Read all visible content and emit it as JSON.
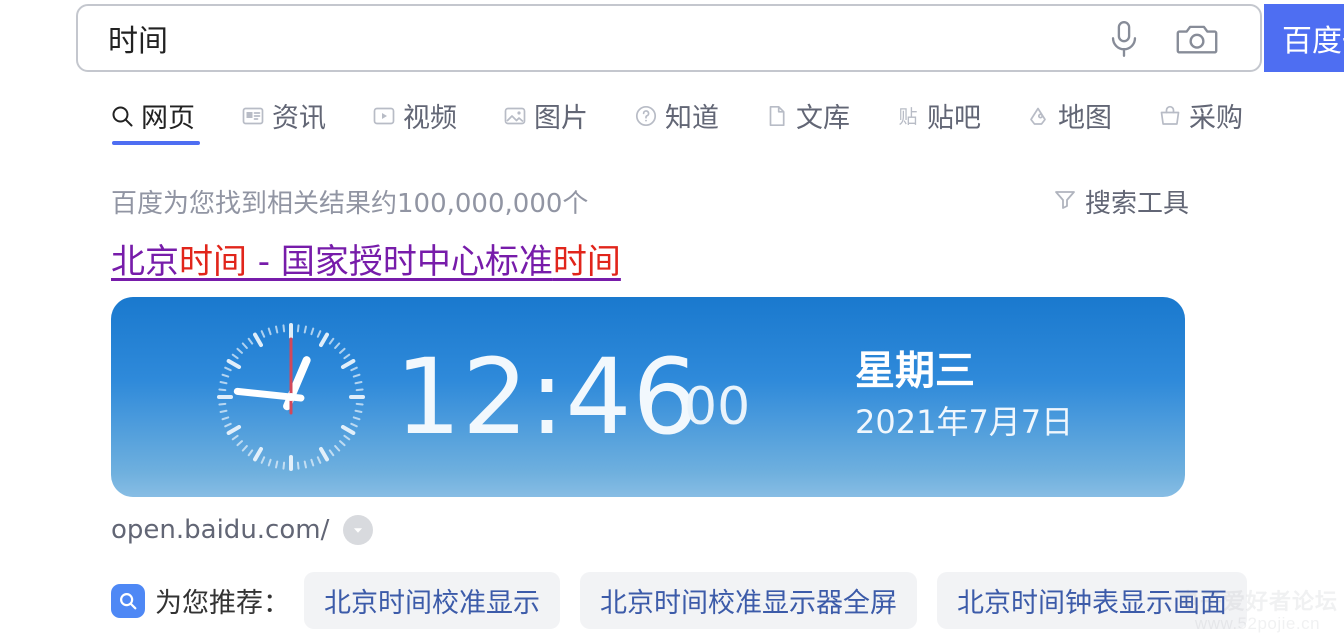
{
  "header": {
    "logo_text": "度",
    "search_value": "时间",
    "search_placeholder": "",
    "mic_icon": "microphone-icon",
    "camera_icon": "camera-icon",
    "search_button_label": "百度一下"
  },
  "tabs": [
    {
      "label": "网页",
      "icon": "search-icon",
      "active": true
    },
    {
      "label": "资讯",
      "icon": "news-icon",
      "active": false
    },
    {
      "label": "视频",
      "icon": "video-icon",
      "active": false
    },
    {
      "label": "图片",
      "icon": "image-icon",
      "active": false
    },
    {
      "label": "知道",
      "icon": "question-icon",
      "active": false
    },
    {
      "label": "文库",
      "icon": "document-icon",
      "active": false
    },
    {
      "label": "贴吧",
      "icon": "tieba-icon",
      "active": false
    },
    {
      "label": "地图",
      "icon": "map-pin-icon",
      "active": false
    },
    {
      "label": "采购",
      "icon": "basket-icon",
      "active": false
    }
  ],
  "results_meta": {
    "count_text": "百度为您找到相关结果约100,000,000个",
    "search_tools_label": "搜索工具",
    "filter_icon": "funnel-icon"
  },
  "result": {
    "title_parts": [
      {
        "text": "北京",
        "highlight": false
      },
      {
        "text": "时间",
        "highlight": true
      },
      {
        "text": " - 国家授时中心标准",
        "highlight": false
      },
      {
        "text": "时间",
        "highlight": true
      }
    ],
    "title_plain": "北京时间 - 国家授时中心标准时间",
    "source_url": "open.baidu.com/",
    "caret_icon": "chevron-down-icon"
  },
  "clock_widget": {
    "time_hhmm": "12:46",
    "seconds": "00",
    "weekday": "星期三",
    "date": "2021年7月7日",
    "analog_icon": "analog-clock-icon",
    "hour_angle_deg": 23,
    "minute_angle_deg": 276,
    "second_angle_deg": 0,
    "gradient_top": "#1a79ce",
    "gradient_bottom": "#87bde4"
  },
  "recommend": {
    "icon": "search-badge-icon",
    "label": "为您推荐：",
    "chips": [
      "北京时间校准显示",
      "北京时间校准显示器全屏",
      "北京时间钟表显示画面"
    ]
  },
  "watermark": {
    "line1": "电子爱好者论坛",
    "line2": "www.52pojie.cn"
  },
  "colors": {
    "brand_red": "#d7242b",
    "brand_blue": "#4e6ef2",
    "visited_link": "#771caa",
    "highlight_red": "#e1251b"
  }
}
